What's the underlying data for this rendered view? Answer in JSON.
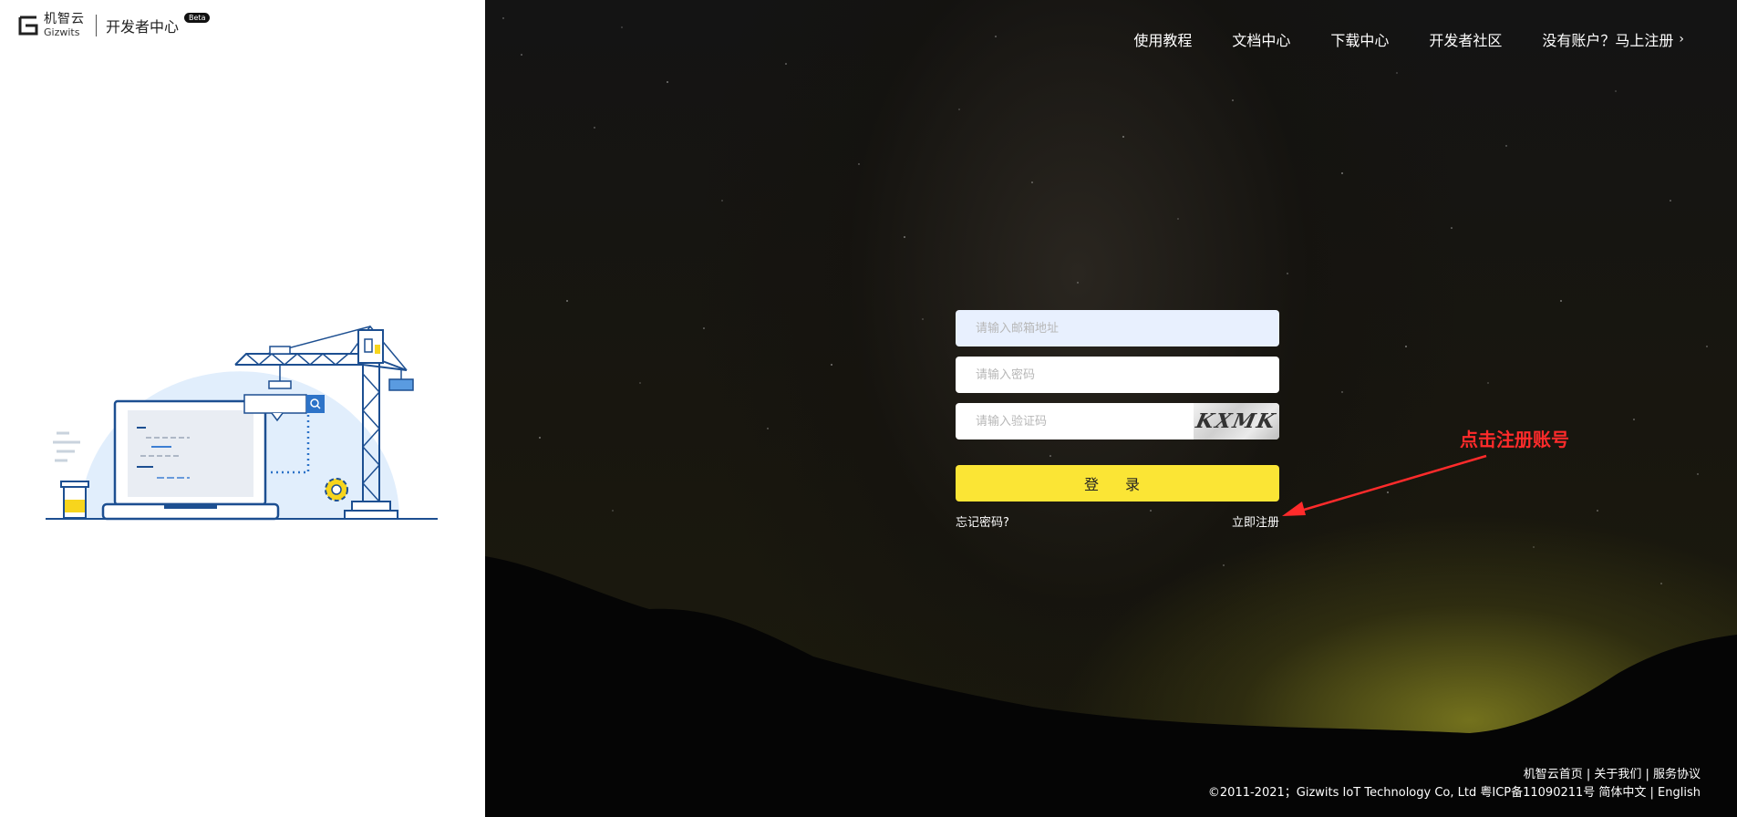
{
  "brand": {
    "logo_cn": "机智云",
    "logo_en": "Gizwits",
    "title": "开发者中心",
    "badge": "Beta"
  },
  "nav": {
    "items": [
      "使用教程",
      "文档中心",
      "下载中心",
      "开发者社区"
    ],
    "register_label": "没有账户？马上注册"
  },
  "form": {
    "email_placeholder": "请输入邮箱地址",
    "password_placeholder": "请输入密码",
    "captcha_placeholder": "请输入验证码",
    "captcha_text": "KXMK",
    "login_label": "登 录",
    "forgot_label": "忘记密码?",
    "register_now_label": "立即注册"
  },
  "annotation": {
    "text": "点击注册账号",
    "color": "#ff2b2b"
  },
  "footer": {
    "links_line": "机智云首页 | 关于我们 | 服务协议",
    "copyright_line": "©2011-2021；Gizwits IoT Technology Co, Ltd 粤ICP备11090211号 简体中文 | English"
  },
  "colors": {
    "login_button": "#fbe535",
    "email_field_bg": "#e8f0fe"
  }
}
